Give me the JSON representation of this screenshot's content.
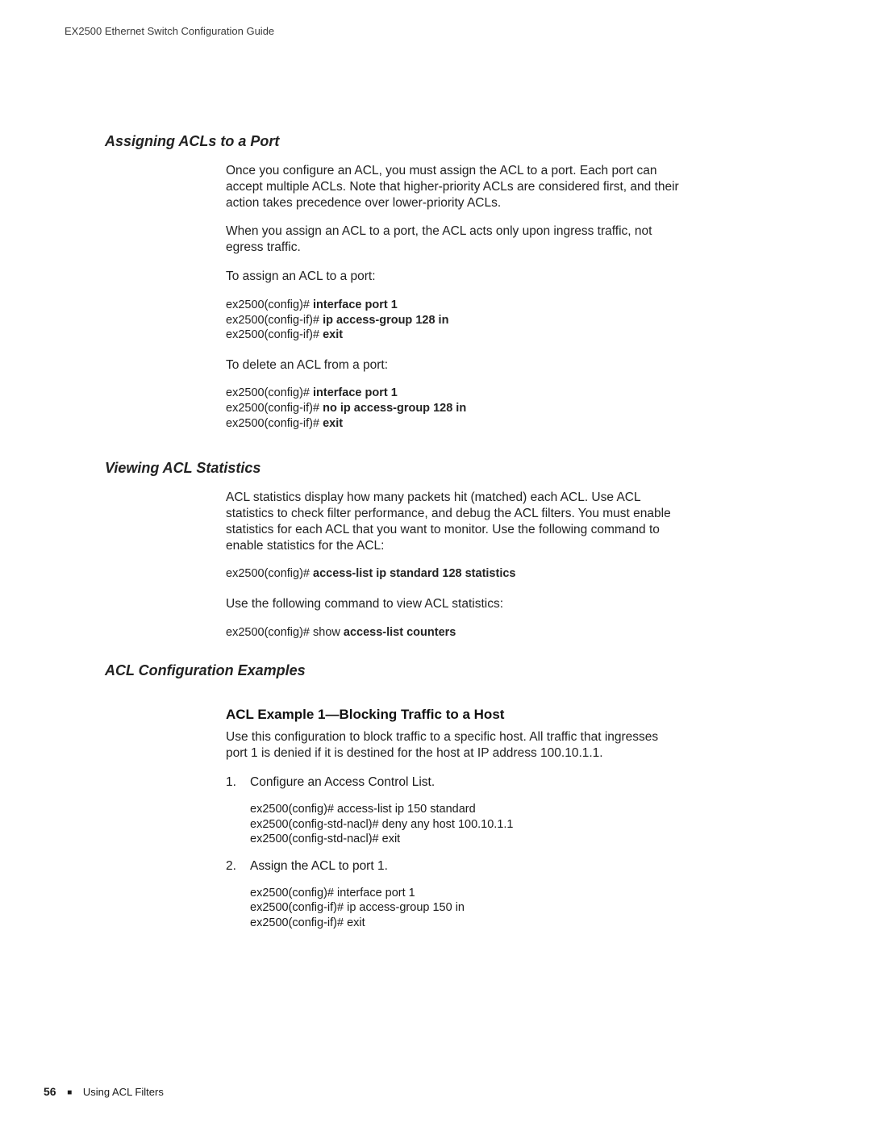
{
  "header": {
    "running": "EX2500 Ethernet Switch Configuration Guide"
  },
  "sections": {
    "assigning": {
      "heading": "Assigning ACLs to a Port",
      "p1": "Once you configure an ACL, you must assign the ACL to a port. Each port can accept multiple ACLs. Note that higher-priority ACLs are considered first, and their action takes precedence over lower-priority ACLs.",
      "p2": "When you assign an ACL to a port, the ACL acts only upon ingress traffic, not egress traffic.",
      "p3": "To assign an ACL to a port:",
      "cmd1": {
        "l1p": "ex2500(config)# ",
        "l1b": "interface port 1",
        "l2p": "ex2500(config-if)# ",
        "l2b": "ip access-group 128 in",
        "l3p": "ex2500(config-if)# ",
        "l3b": "exit"
      },
      "p4": "To delete an ACL from a port:",
      "cmd2": {
        "l1p": "ex2500(config)# ",
        "l1b": "interface port 1",
        "l2p": "ex2500(config-if)# ",
        "l2b": "no ip access-group 128 in",
        "l3p": "ex2500(config-if)# ",
        "l3b": "exit"
      }
    },
    "viewing": {
      "heading": "Viewing ACL Statistics",
      "p1": "ACL statistics display how many packets hit (matched) each ACL. Use ACL statistics to check filter performance, and debug the ACL filters. You must enable statistics for each ACL that you want to monitor. Use the following command to enable statistics for the ACL:",
      "cmd1": {
        "l1p": "ex2500(config)# ",
        "l1b": "access-list ip standard 128 statistics"
      },
      "p2": "Use the following command to view ACL statistics:",
      "cmd2": {
        "l1p": "ex2500(config)# show ",
        "l1b": "access-list counters"
      }
    },
    "examples": {
      "heading": "ACL Configuration Examples",
      "ex1": {
        "title": "ACL Example 1—Blocking Traffic to a Host",
        "p1a": "Use this configuration to block traffic to a specific host. All traffic that ingresses port 1 is denied if it is destined for the host at IP address ",
        "ip": "100.10.1.1.",
        "step1_num": "1.",
        "step1_text": "Configure an Access Control List.",
        "step1_cmd": {
          "l1p": "ex2500(config)# ",
          "l1b": "access-list ip 150 standard",
          "l2p": "ex2500(config-std-nacl)# ",
          "l2b": "deny any host 100.10.1.1",
          "l3p": "ex2500(config-std-nacl)# ",
          "l3b": "exit"
        },
        "step2_num": "2.",
        "step2_text": "Assign the ACL to port 1.",
        "step2_cmd": {
          "l1p": "ex2500(config)# ",
          "l1b": "interface port 1",
          "l2p": "ex2500(config-if)# ",
          "l2b": "ip access-group 150 in",
          "l3p": "ex2500(config-if)# ",
          "l3b": "exit"
        }
      }
    }
  },
  "footer": {
    "pagenum": "56",
    "square": "■",
    "section": "Using ACL Filters"
  }
}
